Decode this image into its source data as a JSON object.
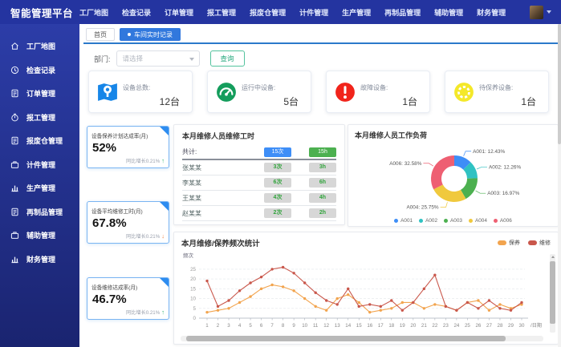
{
  "app": {
    "title": "智能管理平台"
  },
  "topnav": {
    "items": [
      "工厂地图",
      "检查记录",
      "订单管理",
      "报工管理",
      "报废仓管理",
      "计件管理",
      "生产管理",
      "再制品管理",
      "辅助管理",
      "财务管理"
    ]
  },
  "sidebar": {
    "items": [
      "工厂地图",
      "检查记录",
      "订单管理",
      "报工管理",
      "报废仓管理",
      "计件管理",
      "生产管理",
      "再制品管理",
      "辅助管理",
      "财务管理"
    ]
  },
  "tabs": {
    "home": "首页",
    "active": "车间实时记录"
  },
  "filter": {
    "label": "部门:",
    "select_value": "请选择",
    "search_button": "查询"
  },
  "stat_cards": [
    {
      "label": "设备总数:",
      "value": "12台",
      "icon": "map-pin-icon",
      "color": "#1786e8"
    },
    {
      "label": "运行中设备:",
      "value": "5台",
      "icon": "gauge-icon",
      "color": "#149d5c"
    },
    {
      "label": "故障设备:",
      "value": "1台",
      "icon": "alert-icon",
      "color": "#f1241b"
    },
    {
      "label": "待保养设备:",
      "value": "1台",
      "icon": "maintenance-icon",
      "color": "#f4e829"
    }
  ],
  "kpi_cards": [
    {
      "title": "设备保养计划达成率(月)",
      "value": "52%",
      "trend_text": "同比增长0.21%",
      "trend": "up",
      "trend_icon": "↑"
    },
    {
      "title": "设备平均维修工时(月)",
      "value": "67.8%",
      "trend_text": "同比增长0.21%",
      "trend": "down",
      "trend_icon": "↓"
    },
    {
      "title": "设备维修达成率(月)",
      "value": "46.7%",
      "trend_text": "同比增长0.21%",
      "trend": "up",
      "trend_icon": "↑"
    }
  ],
  "worker_table": {
    "title": "本月维修人员维修工时",
    "total_label": "共计:",
    "total_times": "15次",
    "total_hours": "15h",
    "rows": [
      {
        "name": "张某某",
        "times": "3次",
        "hours": "3h"
      },
      {
        "name": "李某某",
        "times": "6次",
        "hours": "6h"
      },
      {
        "name": "王某某",
        "times": "4次",
        "hours": "4h"
      },
      {
        "name": "赵某某",
        "times": "2次",
        "hours": "2h"
      }
    ]
  },
  "chart_data": [
    {
      "type": "pie",
      "donut": true,
      "title": "本月维修人员工作负荷",
      "labels": [
        "A001",
        "A002",
        "A003",
        "A004",
        "A006"
      ],
      "values": [
        12.43,
        12.26,
        16.97,
        25.75,
        32.58
      ],
      "colors": [
        "#3e8ef7",
        "#2fc2c2",
        "#4cb050",
        "#f0c93d",
        "#ee5f72"
      ],
      "label_format": "{name}: {value}%",
      "legend_position": "bottom"
    },
    {
      "type": "line",
      "title": "本月维修/保养频次统计",
      "ylabel": "频次",
      "xlabel": "/日期",
      "ylim": [
        0,
        27
      ],
      "yticks": [
        0,
        5,
        10,
        15,
        20,
        25
      ],
      "x": [
        1,
        2,
        3,
        4,
        5,
        6,
        7,
        8,
        9,
        10,
        11,
        12,
        13,
        14,
        15,
        16,
        17,
        18,
        19,
        20,
        21,
        22,
        23,
        24,
        25,
        26,
        27,
        28,
        29,
        30
      ],
      "series": [
        {
          "name": "保养",
          "color": "#f2a44e",
          "values": [
            3,
            4,
            5,
            8,
            11,
            15,
            17,
            16,
            14,
            10,
            6,
            4,
            10,
            12,
            8,
            3,
            4,
            5,
            8,
            8,
            5,
            7,
            6,
            4,
            8,
            9,
            4,
            7,
            5,
            7
          ]
        },
        {
          "name": "维修",
          "color": "#c9574b",
          "values": [
            19,
            6,
            9,
            14,
            18,
            21,
            25,
            26,
            23,
            18,
            13,
            9,
            7,
            15,
            6,
            7,
            6,
            9,
            4,
            8,
            15,
            22,
            6,
            4,
            8,
            5,
            9,
            5,
            4,
            8
          ]
        }
      ],
      "legend_position": "top-right",
      "grid": "dashed"
    }
  ]
}
